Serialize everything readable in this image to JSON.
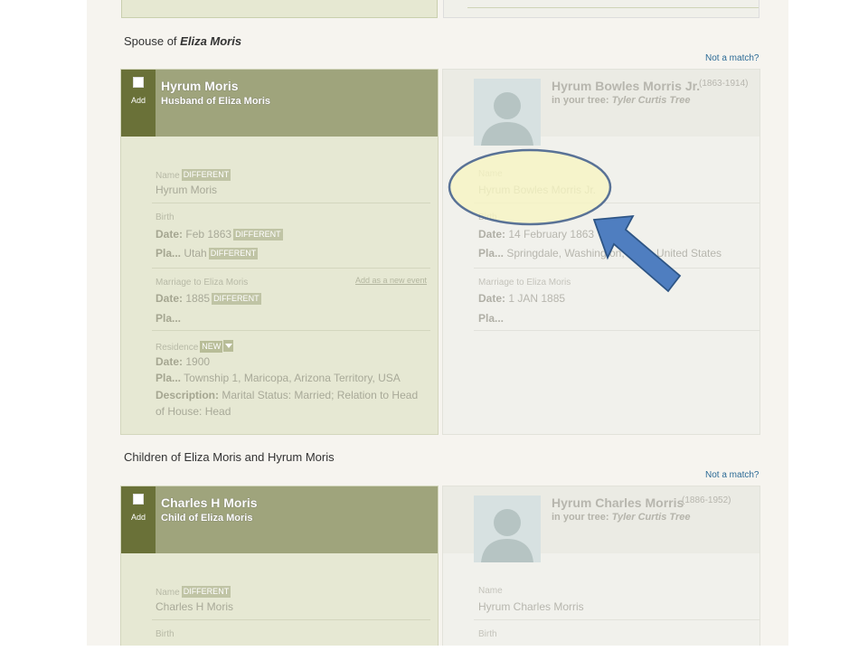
{
  "spouse_section": {
    "title_prefix": "Spouse of",
    "title_name": "Eliza Moris",
    "not_match": "Not a match?",
    "left": {
      "add_label": "Add",
      "name": "Hyrum Moris",
      "relation": "Husband of Eliza Moris",
      "name_label": "Name",
      "name_badge": "DIFFERENT",
      "name_value": "Hyrum Moris",
      "birth_label": "Birth",
      "date_key": "Date:",
      "birth_date": "Feb 1863",
      "birth_date_badge": "DIFFERENT",
      "place_key": "Pla...",
      "birth_place": "Utah",
      "birth_place_badge": "DIFFERENT",
      "marriage_label": "Marriage to Eliza Moris",
      "add_event": "Add as a new event",
      "marriage_date": "1885",
      "marriage_date_badge": "DIFFERENT",
      "residence_label": "Residence",
      "residence_badge": "NEW",
      "residence_date": "1900",
      "residence_place": "Township 1, Maricopa, Arizona Territory, USA",
      "description_key": "Description:",
      "description_line1": "Marital Status: Married; Relation to Head",
      "description_line2": "of House: Head"
    },
    "right": {
      "name": "Hyrum Bowles Morris Jr.",
      "lifespan": "(1863-1914)",
      "in_tree_prefix": "in your tree:",
      "tree_name": "Tyler Curtis Tree",
      "name_label": "Name",
      "name_value": "Hyrum Bowles Morris Jr.",
      "birth_label": "Birth",
      "date_key": "Date:",
      "birth_date": "14 February 1863",
      "place_key": "Pla...",
      "birth_place": "Springdale, Washington, Utah, United States",
      "marriage_label": "Marriage to Eliza Moris",
      "marriage_date": "1 JAN 1885"
    }
  },
  "children_section": {
    "title": "Children of Eliza Moris and Hyrum Moris",
    "not_match": "Not a match?",
    "left": {
      "add_label": "Add",
      "name": "Charles H Moris",
      "relation": "Child of Eliza Moris",
      "name_label": "Name",
      "name_badge": "DIFFERENT",
      "name_value": "Charles H Moris",
      "birth_label": "Birth"
    },
    "right": {
      "name": "Hyrum Charles Morris",
      "lifespan": "(1886-1952)",
      "in_tree_prefix": "in your tree:",
      "tree_name": "Tyler Curtis Tree",
      "name_label": "Name",
      "name_value": "Hyrum Charles Morris",
      "birth_label": "Birth"
    }
  },
  "annotation": {
    "ellipse_fill": "#f8f6c2",
    "ellipse_stroke": "#2f4f7f",
    "arrow_fill": "#4f7ec0",
    "arrow_stroke": "#2e5585"
  }
}
